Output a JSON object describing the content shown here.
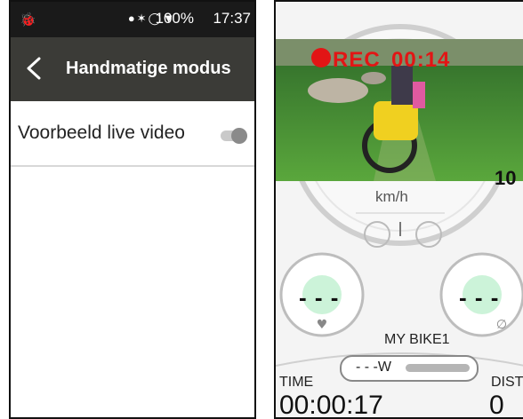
{
  "left": {
    "status_bar": {
      "battery": "100%",
      "time": "17:37"
    },
    "header": {
      "title": "Handmatige modus"
    },
    "settings": [
      {
        "label": "Voorbeeld live video",
        "enabled": false
      }
    ]
  },
  "right": {
    "video": {
      "rec_label": "REC",
      "rec_time": "00:14"
    },
    "speedometer": {
      "unit": "km/h",
      "value_partial": "10"
    },
    "gauges": {
      "left_value": "- - -",
      "right_value": "- - -"
    },
    "bike_name": "MY BIKE1",
    "power": {
      "value": "- - -W"
    },
    "time": {
      "label": "TIME",
      "value": "00:00:17"
    },
    "distance": {
      "label": "DIST",
      "value": "0"
    }
  },
  "colors": {
    "status_bar": "#1a1a1a",
    "app_bar": "#3b3b37",
    "rec": "#e21515",
    "accent_glow": "#39d26b"
  }
}
